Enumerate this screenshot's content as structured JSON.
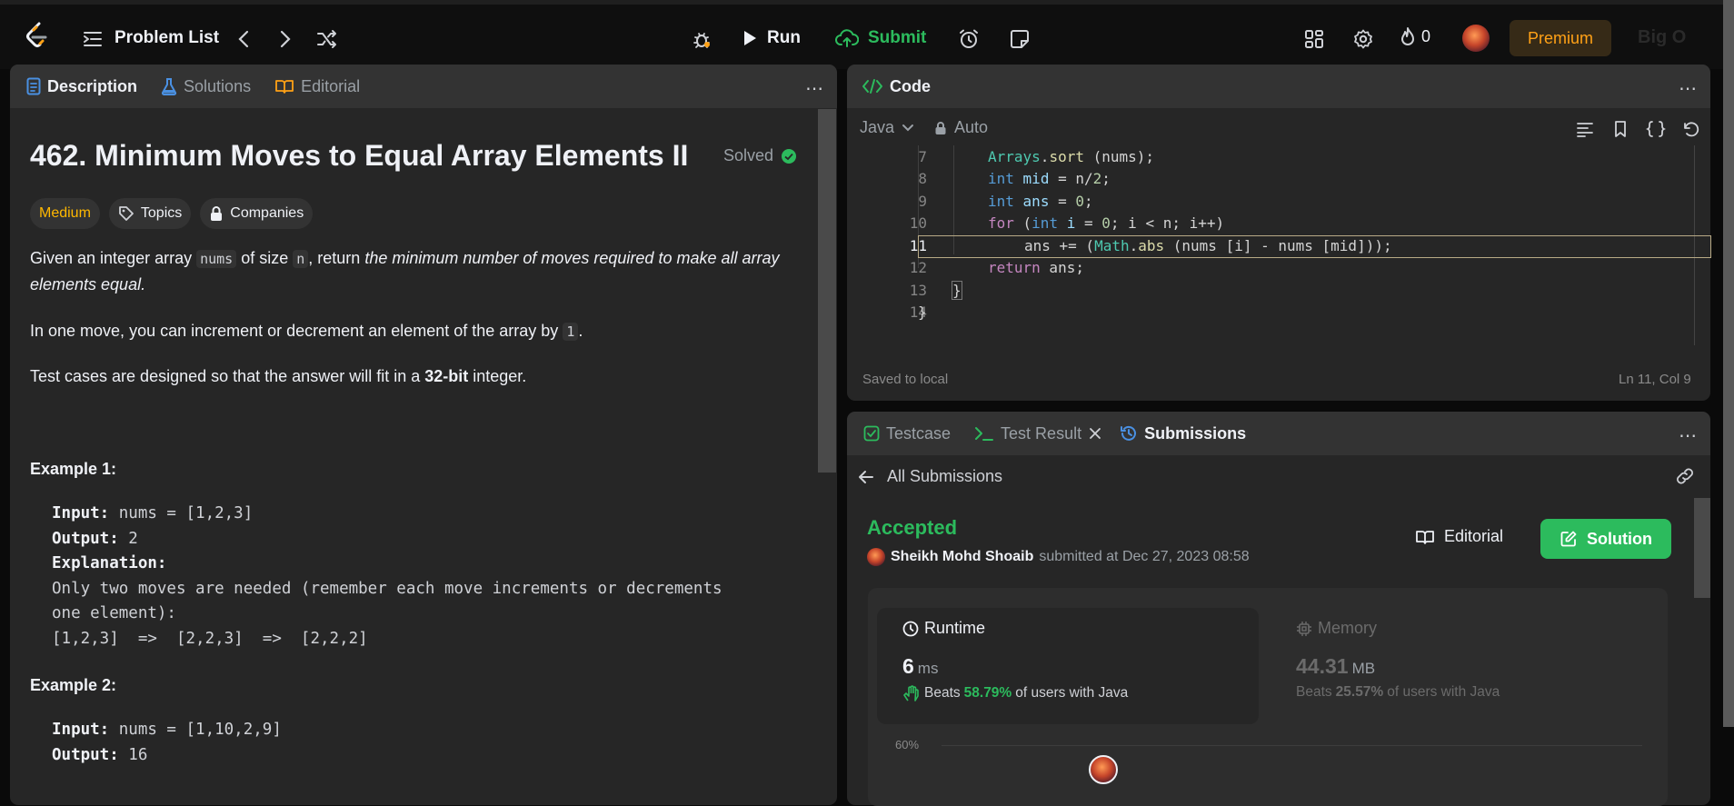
{
  "nav": {
    "problem_list": "Problem List",
    "run": "Run",
    "submit": "Submit",
    "streak_count": "0",
    "premium": "Premium",
    "big_o": "Big O"
  },
  "description": {
    "tabs": [
      "Description",
      "Solutions",
      "Editorial"
    ],
    "title": "462. Minimum Moves to Equal Array Elements II",
    "solved": "Solved",
    "difficulty": "Medium",
    "topics": "Topics",
    "companies": "Companies",
    "para1_a": "Given an integer array ",
    "para1_code1": "nums",
    "para1_b": " of size ",
    "para1_code2": "n",
    "para1_c": ", return ",
    "para1_em": "the minimum number of moves required to make all array elements equal.",
    "para2_a": "In one move, you can increment or decrement an element of the array by ",
    "para2_code": "1",
    "para2_b": ".",
    "para3_a": "Test cases are designed so that the answer will fit in a ",
    "para3_bold": "32-bit",
    "para3_b": " integer.",
    "example1_title": "Example 1:",
    "example1_input_label": "Input:",
    "example1_input": " nums = [1,2,3]",
    "example1_output_label": "Output:",
    "example1_output": " 2",
    "example1_expl_label": "Explanation:",
    "example1_expl_line1": "Only two moves are needed (remember each move increments or decrements",
    "example1_expl_line2": "one element):",
    "example1_expl_line3": "[1,2,3]  =>  [2,2,3]  =>  [2,2,2]",
    "example2_title": "Example 2:",
    "example2_input_label": "Input:",
    "example2_input": " nums = [1,10,2,9]",
    "example2_output_label": "Output:",
    "example2_output": " 16"
  },
  "code": {
    "tab": "Code",
    "language": "Java",
    "auto": "Auto",
    "line_numbers": [
      "7",
      "8",
      "9",
      "10",
      "11",
      "12",
      "13",
      "14"
    ],
    "saved": "Saved to local",
    "cursor": "Ln 11, Col 9"
  },
  "submissions": {
    "tabs": [
      "Testcase",
      "Test Result",
      "Submissions"
    ],
    "all_submissions": "All Submissions",
    "status": "Accepted",
    "user": "Sheikh Mohd Shoaib",
    "submitted_at": "submitted at Dec 27, 2023 08:58",
    "editorial": "Editorial",
    "solution": "Solution",
    "runtime_label": "Runtime",
    "runtime_value": "6",
    "runtime_unit": "ms",
    "runtime_beats_prefix": "Beats",
    "runtime_beats": "58.79%",
    "runtime_beats_suffix": "of users with Java",
    "memory_label": "Memory",
    "memory_value": "44.31",
    "memory_unit": "MB",
    "memory_beats_prefix": "Beats",
    "memory_beats": "25.57%",
    "memory_beats_suffix": "of users with Java",
    "axis_label": "60%"
  },
  "colors": {
    "accent_green": "#2cbb5d",
    "medium_yellow": "#ffb800",
    "premium_orange": "#ffa116"
  }
}
